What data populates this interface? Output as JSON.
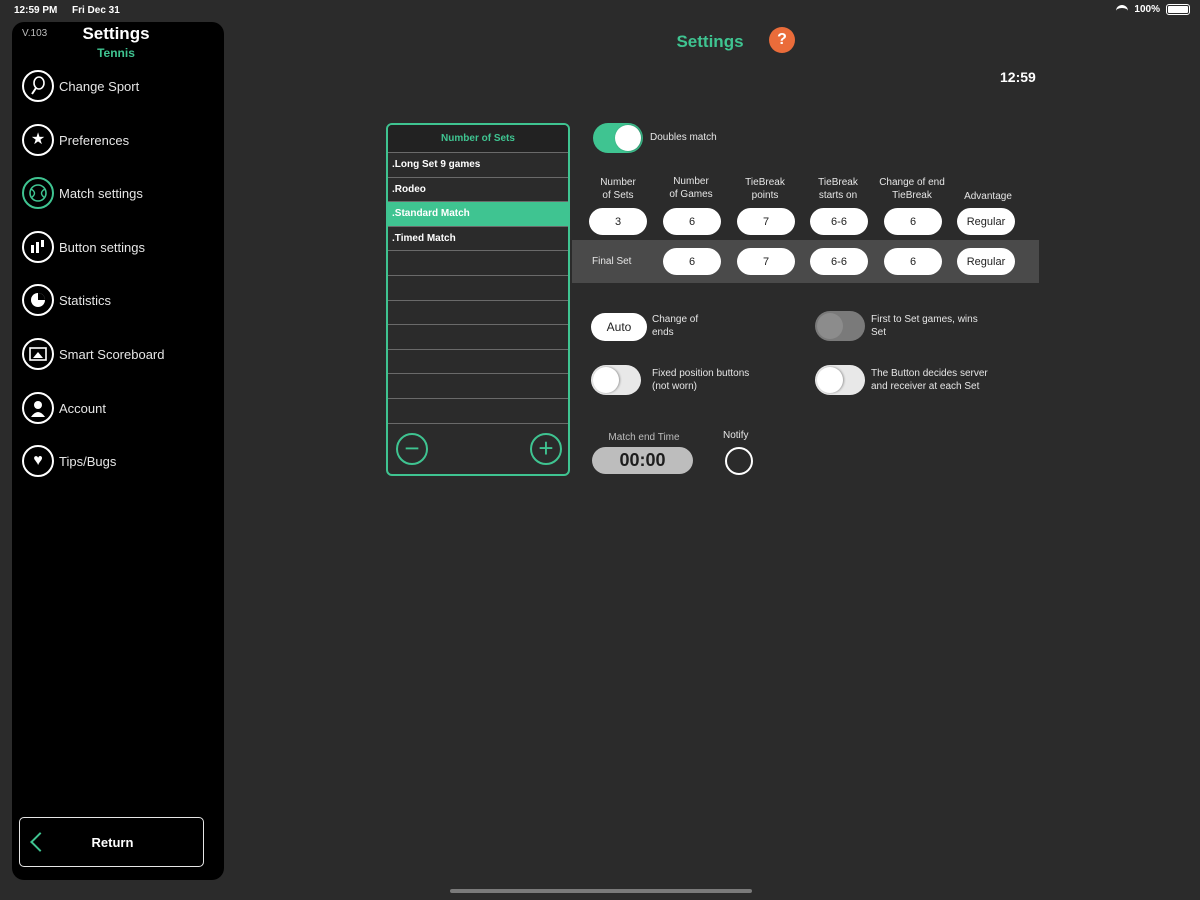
{
  "status": {
    "time": "12:59 PM",
    "date": "Fri Dec 31",
    "battery": "100%"
  },
  "sidebar": {
    "version": "V.103",
    "title": "Settings",
    "subtitle": "Tennis",
    "items": [
      {
        "label": "Change Sport",
        "icon": "tennis-racket-icon"
      },
      {
        "label": "Preferences",
        "icon": "star-icon"
      },
      {
        "label": "Match settings",
        "icon": "tennis-ball-icon"
      },
      {
        "label": "Button settings",
        "icon": "button-settings-icon"
      },
      {
        "label": "Statistics",
        "icon": "statistics-icon"
      },
      {
        "label": "Smart Scoreboard",
        "icon": "scoreboard-icon"
      },
      {
        "label": "Account",
        "icon": "account-icon"
      },
      {
        "label": "Tips/Bugs",
        "icon": "heart-icon"
      }
    ],
    "return_label": "Return"
  },
  "header": {
    "title": "Settings",
    "help": "?",
    "clock": "12:59"
  },
  "sets_panel": {
    "header": "Number of Sets",
    "items": [
      ".Long Set 9 games",
      ".Rodeo",
      ".Standard Match",
      ".Timed Match"
    ],
    "selected": ".Standard Match",
    "remove": "−",
    "add": "+"
  },
  "doubles": {
    "label": "Doubles match",
    "on": true
  },
  "columns": {
    "sets": [
      "Number",
      "of Sets"
    ],
    "games": [
      "Number",
      "of Games"
    ],
    "tiebreak_points": [
      "TieBreak",
      "points"
    ],
    "tiebreak_starts": [
      "TieBreak",
      "starts on"
    ],
    "change_end": [
      "Change of end",
      "TieBreak"
    ],
    "advantage": "Advantage"
  },
  "main_row": {
    "sets": "3",
    "games": "6",
    "tiebreak_points": "7",
    "tiebreak_starts": "6-6",
    "change_end": "6",
    "advantage": "Regular"
  },
  "final_set": {
    "label": "Final Set",
    "games": "6",
    "tiebreak_points": "7",
    "tiebreak_starts": "6-6",
    "change_end": "6",
    "advantage": "Regular"
  },
  "options": {
    "change_of_ends": {
      "button": "Auto",
      "label": [
        "Change of",
        "ends"
      ]
    },
    "first_to_set": {
      "label": [
        "First to Set games, wins",
        "Set"
      ],
      "on": false,
      "disabled": true
    },
    "fixed_buttons": {
      "label": [
        "Fixed position buttons",
        "(not worn)"
      ],
      "on": false
    },
    "button_decides": {
      "label": [
        "The Button decides server",
        "and receiver at each Set"
      ],
      "on": false
    }
  },
  "timer": {
    "label": "Match end Time",
    "value": "00:00"
  },
  "notify": {
    "label": "Notify",
    "checked": false
  },
  "colors": {
    "accent": "#3fc491",
    "help": "#ea6c3a",
    "background": "#2b2b2b",
    "sidebar": "#000000"
  }
}
